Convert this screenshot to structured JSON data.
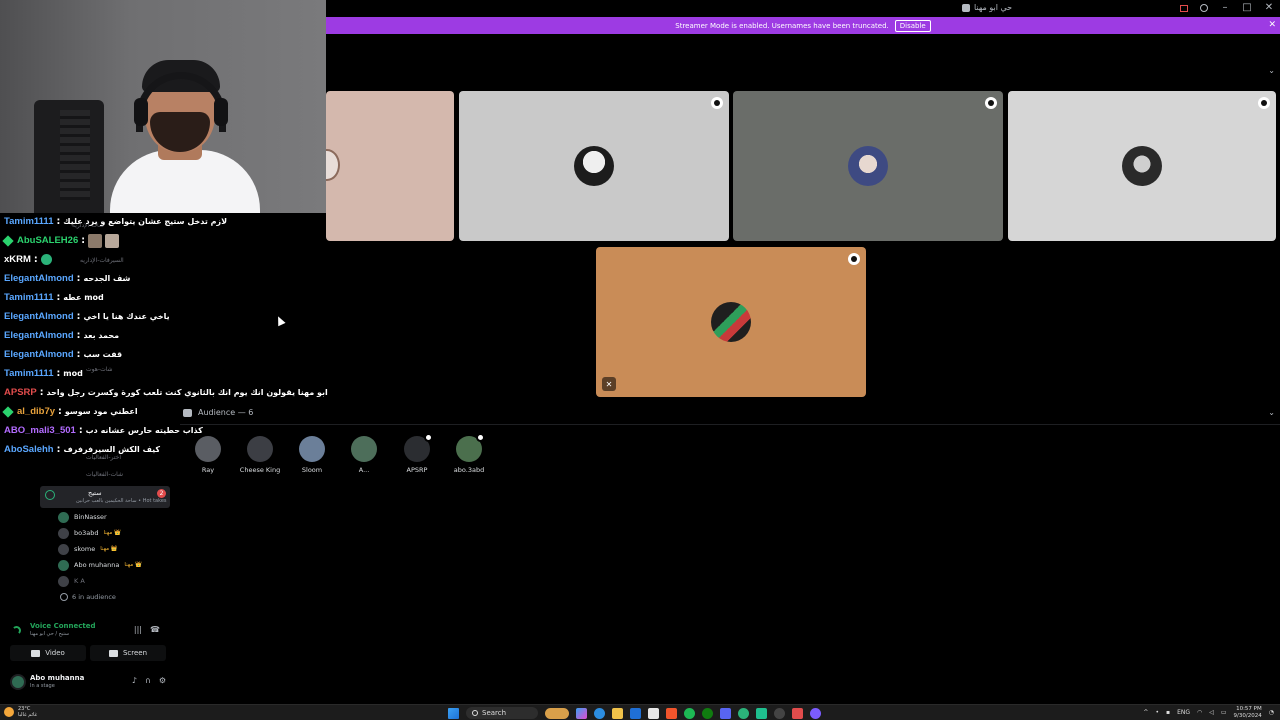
{
  "window": {
    "title": "حي ابو مهنا"
  },
  "banner": {
    "text": "Streamer Mode is enabled. Usernames have been truncated.",
    "disable_label": "Disable",
    "color": "#9d3be3"
  },
  "stage_tiles": [
    {
      "name": "partial-tile",
      "bg": "#d4b8ad"
    },
    {
      "name": "tile-2",
      "bg": "#c9c9c9"
    },
    {
      "name": "tile-3",
      "bg": "#6a6d69"
    },
    {
      "name": "tile-4",
      "bg": "#d6d6d6"
    },
    {
      "name": "tile-5",
      "bg": "#c98c57"
    }
  ],
  "audience": {
    "header": "Audience — 6",
    "members": [
      {
        "name": "Ray",
        "color": "#5a5d63"
      },
      {
        "name": "Cheese King",
        "color": "#3c3e44"
      },
      {
        "name": "Sloom",
        "color": "#6b7f99"
      },
      {
        "name": "A...",
        "color": "#4d6e5a"
      },
      {
        "name": "APSRP",
        "color": "#2b2d31"
      },
      {
        "name": "abo.3abd",
        "color": "#4b6f4d"
      }
    ]
  },
  "chat": [
    {
      "user": "Tamim1111",
      "color": "#5aa7ff",
      "msg": "لازم تدخل ستيج عشان يتواضع و يرد عليك"
    },
    {
      "user": "AbuSALEH26",
      "color": "#2bd36e",
      "msg": "",
      "gem": true,
      "emotes": 2
    },
    {
      "user": "xKRM",
      "color": "#ffffff",
      "msg": "",
      "emote_round": true
    },
    {
      "user": "ElegantAlmond",
      "color": "#5aa7ff",
      "msg": "شف الجدحه"
    },
    {
      "user": "Tamim1111",
      "color": "#5aa7ff",
      "msg": "عطه mod"
    },
    {
      "user": "ElegantAlmond",
      "color": "#5aa7ff",
      "msg": "ياخي عندك هنا يا اخي"
    },
    {
      "user": "ElegantAlmond",
      "color": "#5aa7ff",
      "msg": "محمد بعد"
    },
    {
      "user": "ElegantAlmond",
      "color": "#5aa7ff",
      "msg": "قفت سب"
    },
    {
      "user": "Tamim1111",
      "color": "#5aa7ff",
      "msg": "mod"
    },
    {
      "user": "APSRP",
      "color": "#e24c4c",
      "msg": "ابو مهنا يقولون انك يوم انك بالثانوي كنت تلعب كورة وكسرت رجل واحد"
    },
    {
      "user": "al_dib7y",
      "color": "#e8a23c",
      "msg": "اعطني مود سوسو",
      "gem": true
    },
    {
      "user": "ABO_mali3_501",
      "color": "#b36cff",
      "msg": "كذاب حطيته حارس عشانه دب"
    },
    {
      "user": "AboSalehh",
      "color": "#5aa7ff",
      "msg": "كيف الكش السيرفرفرف"
    }
  ],
  "sidebar": {
    "labels": [
      "شات-الإداريه",
      "السيرفات-الإداريه",
      "اختر-الفعاليات",
      "شات-الفعاليات",
      "شات-هوت"
    ],
    "voice_channel": {
      "name": "ستيج",
      "topic": "ساحة الحكيمين بالعب حرانين • Hot takes",
      "count": "2"
    },
    "voice_members": [
      {
        "name": "BinNasser",
        "tag": ""
      },
      {
        "name": "bo3abd",
        "tag": "مهنا 👑"
      },
      {
        "name": "skome",
        "tag": "مهنا 👑"
      },
      {
        "name": "Abo muhanna",
        "tag": "مهنا 👑"
      },
      {
        "name": "K A",
        "tag": ""
      }
    ],
    "audience_count": "6 in audience"
  },
  "voice_panel": {
    "status": "Voice Connected",
    "sub": "ستيج / حي ابو مهنا",
    "video_label": "Video",
    "screen_label": "Screen"
  },
  "user_panel": {
    "name": "Abo muhanna",
    "status": "In a stage"
  },
  "taskbar": {
    "weather_temp": "23°C",
    "weather_desc": "غائم غالبا",
    "search_label": "Search",
    "lang": "ENG",
    "time": "10:57 PM",
    "date": "9/30/2024"
  }
}
